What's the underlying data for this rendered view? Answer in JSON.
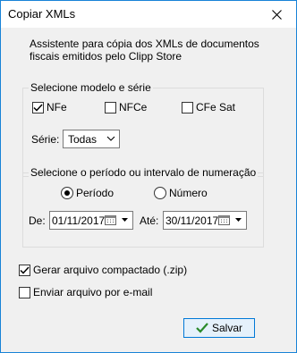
{
  "window": {
    "title": "Copiar XMLs"
  },
  "description": [
    "Assistente para cópia dos XMLs de documentos",
    "fiscais emitidos pelo Clipp Store"
  ],
  "model_group": {
    "legend": "Selecione modelo e série",
    "checkboxes": [
      {
        "label": "NFe",
        "checked": true
      },
      {
        "label": "NFCe",
        "checked": false
      },
      {
        "label": "CFe Sat",
        "checked": false
      }
    ],
    "serie_label": "Série:",
    "serie_value": "Todas"
  },
  "period_group": {
    "legend": "Selecione o período ou intervalo de numeração",
    "radios": [
      {
        "label": "Período",
        "selected": true
      },
      {
        "label": "Número",
        "selected": false
      }
    ],
    "from_label": "De:",
    "from_value": "01/11/2017",
    "to_label": "Até:",
    "to_value": "30/11/2017"
  },
  "options": [
    {
      "label": "Gerar arquivo compactado (.zip)",
      "checked": true
    },
    {
      "label": "Enviar arquivo por e-mail",
      "checked": false
    }
  ],
  "save_button": {
    "label": "Salvar"
  },
  "colors": {
    "accent": "#0078d7",
    "check_green": "#2a8a2a"
  }
}
